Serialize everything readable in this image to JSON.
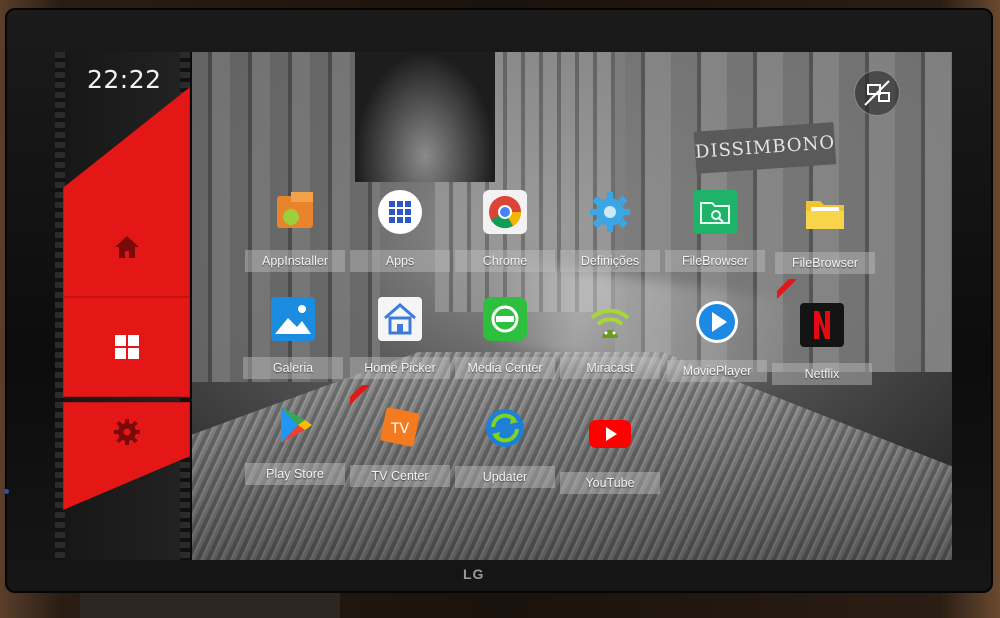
{
  "clock": {
    "time": "22:22"
  },
  "sidebar": {
    "items": [
      {
        "name": "home",
        "icon": "home-icon"
      },
      {
        "name": "apps",
        "icon": "windows-grid-icon"
      },
      {
        "name": "settings",
        "icon": "gear-icon"
      }
    ],
    "accent_color": "#e51616"
  },
  "status": {
    "icon": "network-disconnected-icon"
  },
  "background": {
    "sign_text": "DISSIMBONO"
  },
  "apps": [
    {
      "label": "AppInstaller",
      "icon": "app-installer-icon"
    },
    {
      "label": "Apps",
      "icon": "apps-grid-icon"
    },
    {
      "label": "Chrome",
      "icon": "chrome-icon"
    },
    {
      "label": "Definições",
      "icon": "settings-gear-icon"
    },
    {
      "label": "FileBrowser",
      "icon": "file-browser-icon"
    },
    {
      "label": "FileBrowser",
      "icon": "folder-icon"
    },
    {
      "label": "Galeria",
      "icon": "gallery-icon"
    },
    {
      "label": "Home Picker",
      "icon": "home-picker-icon"
    },
    {
      "label": "Media Center",
      "icon": "media-center-icon"
    },
    {
      "label": "Miracast",
      "icon": "miracast-icon"
    },
    {
      "label": "MoviePlayer",
      "icon": "movie-player-icon"
    },
    {
      "label": "Netflix",
      "icon": "netflix-icon"
    },
    {
      "label": "Play Store",
      "icon": "play-store-icon"
    },
    {
      "label": "TV Center",
      "icon": "tv-center-icon"
    },
    {
      "label": "Updater",
      "icon": "updater-icon"
    },
    {
      "label": "YouTube",
      "icon": "youtube-icon"
    }
  ],
  "tv": {
    "brand": "LG"
  }
}
